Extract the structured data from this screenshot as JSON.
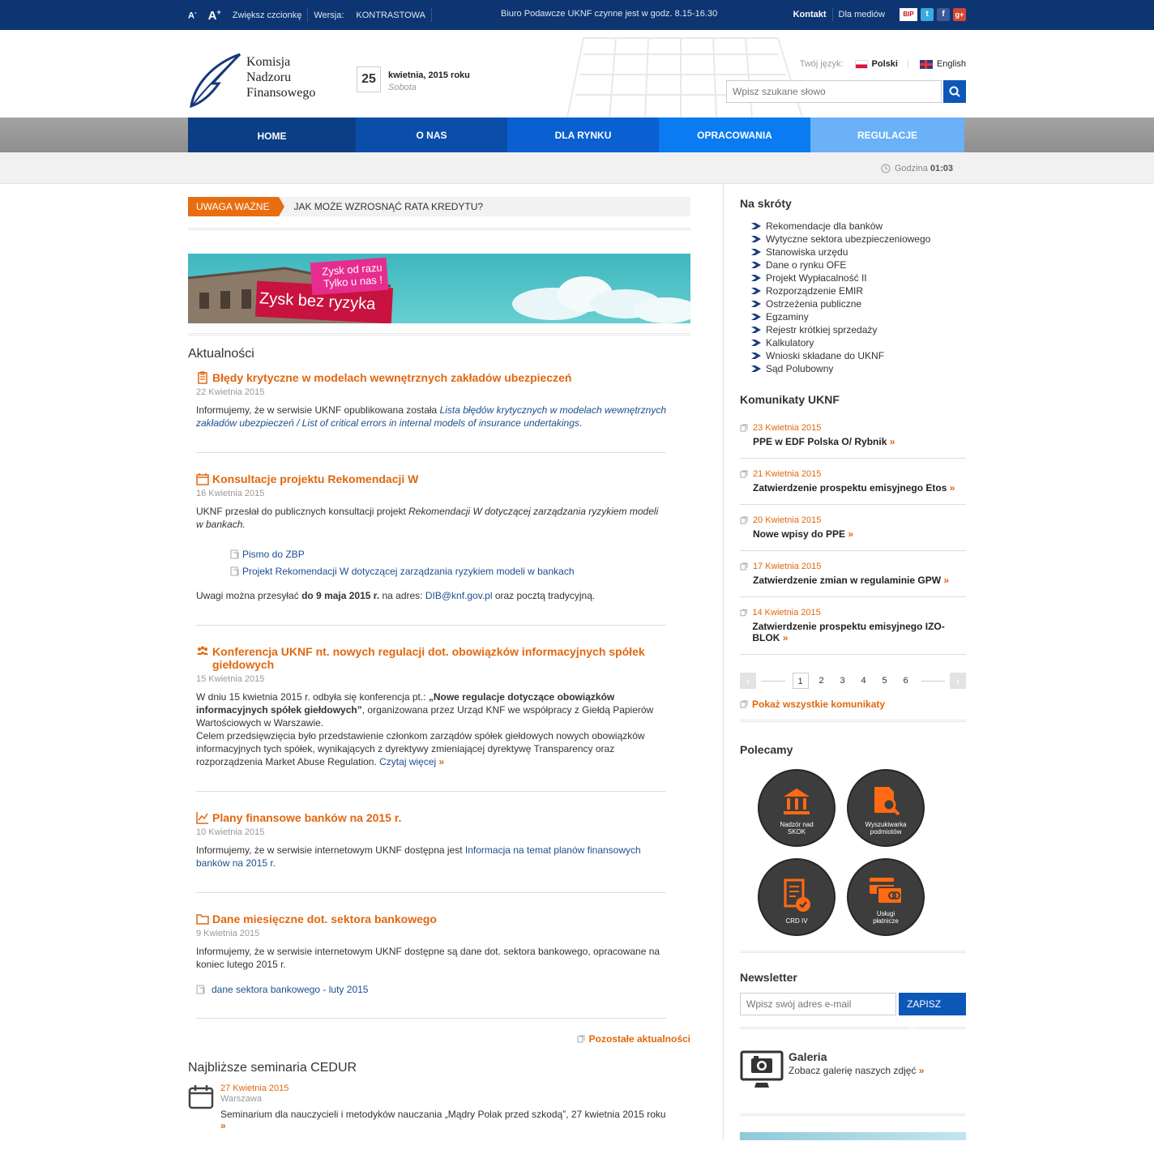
{
  "topbar": {
    "font_small": "A",
    "font_large": "A",
    "font_label": "Zwiększ czcionkę",
    "version_label": "Wersja:",
    "version_value": "KONTRASTOWA",
    "office_hours": "Biuro Podawcze UKNF czynne jest w godz. 8.15-16.30",
    "contact": "Kontakt",
    "media": "Dla mediów",
    "social": [
      "bip-icon",
      "twitter-icon",
      "facebook-icon",
      "googleplus-icon"
    ]
  },
  "header": {
    "logo_lines": [
      "Komisja",
      "Nadzoru",
      "Finansowego"
    ],
    "day": "25",
    "date": "kwietnia, 2015 roku",
    "weekday": "Sobota",
    "lang_label": "Twój język:",
    "lang_pl": "Polski",
    "lang_en": "English",
    "search_placeholder": "Wpisz szukane słowo"
  },
  "nav": [
    {
      "label": "HOME",
      "color": "#0b3e84"
    },
    {
      "label": "O NAS",
      "color": "#0a4eaa"
    },
    {
      "label": "DLA RYNKU",
      "color": "#0a5fd1"
    },
    {
      "label": "OPRACOWANIA",
      "color": "#0a7bf0"
    },
    {
      "label": "REGULACJE",
      "color": "#6ab1f8"
    }
  ],
  "clock": {
    "label": "Godzina",
    "time": "01:03"
  },
  "ticker": {
    "tag": "UWAGA WAŻNE",
    "text": "JAK MOŻE WZROSNĄĆ RATA KREDYTU?"
  },
  "banner": {
    "line1": "Zysk od razu",
    "line2": "Tylko u nas !",
    "line3": "Zysk bez ryzyka"
  },
  "news_heading": "Aktualności",
  "news": [
    {
      "title": "Błędy krytyczne w modelach wewnętrznych zakładów ubezpieczeń",
      "date": "22 Kwietnia 2015",
      "text": "Informujemy, że w serwisie UKNF opublikowana została ",
      "link": "Lista błędów krytycznych w modelach wewnętrznych zakładów ubezpieczeń / List of critical errors in internal models of insurance undertakings",
      "tail": "."
    },
    {
      "title": "Konsultacje projektu Rekomendacji W",
      "date": "16 Kwietnia 2015",
      "text": "UKNF przesłał do publicznych konsultacji projekt ",
      "italic": "Rekomendacji W dotyczącej zarządzania ryzykiem modeli w bankach.",
      "attachments": [
        "Pismo do ZBP",
        "Projekt Rekomendacji W dotyczącej zarządzania ryzykiem modeli w bankach"
      ],
      "note_pre": "Uwagi można przesyłać ",
      "note_bold": "do 9 maja 2015 r.",
      "note_mid": " na adres: ",
      "note_mail": "DIB@knf.gov.pl",
      "note_post": " oraz pocztą tradycyjną."
    },
    {
      "title": "Konferencja UKNF nt. nowych regulacji dot. obowiązków informacyjnych spółek giełdowych",
      "date": "15 Kwietnia 2015",
      "text1": "W dniu 15 kwietnia 2015 r. odbyła się konferencja pt.: ",
      "bold": "„Nowe regulacje dotyczące obowiązków informacyjnych spółek giełdowych”",
      "text2": ", organizowana przez Urząd KNF we współpracy z Giełdą Papierów Wartościowych w Warszawie.",
      "text3": "Celem przedsięwzięcia było przedstawienie członkom zarządów spółek giełdowych nowych obowiązków informacyjnych tych spółek, wynikających z dyrektywy zmieniającej dyrektywę Transparency oraz rozporządzenia Market Abuse Regulation. ",
      "more": "Czytaj więcej"
    },
    {
      "title": "Plany finansowe banków na 2015 r.",
      "date": "10 Kwietnia 2015",
      "text": "Informujemy, że w serwisie internetowym UKNF dostępna jest ",
      "link": "Informacja na temat planów finansowych banków na 2015 r."
    },
    {
      "title": "Dane miesięczne dot. sektora bankowego",
      "date": "9 Kwietnia 2015",
      "text": "Informujemy, że w serwisie internetowym UKNF dostępne są dane dot. sektora bankowego, opracowane na koniec lutego 2015 r.",
      "attachment": "dane sektora bankowego - luty 2015"
    }
  ],
  "news_more": "Pozostałe aktualności",
  "cedur": {
    "heading": "Najbliższe seminaria CEDUR",
    "date": "27 Kwietnia 2015",
    "city": "Warszawa",
    "text": "Seminarium dla nauczycieli i metodyków nauczania „Mądry Polak przed szkodą”, 27 kwietnia 2015 roku"
  },
  "shortcuts": {
    "heading": "Na skróty",
    "items": [
      "Rekomendacje dla banków",
      "Wytyczne sektora ubezpieczeniowego",
      "Stanowiska urzędu",
      "Dane o rynku OFE",
      "Projekt Wypłacalność II",
      "Rozporządzenie EMIR",
      "Ostrzeżenia publiczne",
      "Egzaminy",
      "Rejestr krótkiej sprzedaży",
      "Kalkulatory",
      "Wnioski składane do UKNF",
      "Sąd Polubowny"
    ]
  },
  "komunikaty": {
    "heading": "Komunikaty UKNF",
    "items": [
      {
        "date": "23 Kwietnia 2015",
        "title": "PPE w EDF Polska O/ Rybnik"
      },
      {
        "date": "21 Kwietnia 2015",
        "title": "Zatwierdzenie prospektu emisyjnego Etos"
      },
      {
        "date": "20 Kwietnia 2015",
        "title": "Nowe wpisy do PPE"
      },
      {
        "date": "17 Kwietnia 2015",
        "title": "Zatwierdzenie zmian w regulaminie GPW"
      },
      {
        "date": "14 Kwietnia 2015",
        "title": "Zatwierdzenie prospektu emisyjnego IZO-BLOK"
      }
    ],
    "pages": [
      "1",
      "2",
      "3",
      "4",
      "5",
      "6"
    ],
    "show_all": "Pokaż wszystkie komunikaty"
  },
  "polecamy": {
    "heading": "Polecamy",
    "items": [
      {
        "l1": "Nadzór nad",
        "l2": "SKOK"
      },
      {
        "l1": "Wyszukiwarka",
        "l2": "podmiotów"
      },
      {
        "l1": "CRD IV",
        "l2": ""
      },
      {
        "l1": "Usługi",
        "l2": "płatnicze"
      }
    ]
  },
  "newsletter": {
    "heading": "Newsletter",
    "placeholder": "Wpisz swój adres e-mail",
    "button": "ZAPISZ SIĘ"
  },
  "gallery": {
    "title": "Galeria",
    "text": "Zobacz galerię naszych zdjęć"
  },
  "colors": {
    "navy": "#0d3572",
    "orange": "#e0680f",
    "blue": "#0d57b8"
  }
}
